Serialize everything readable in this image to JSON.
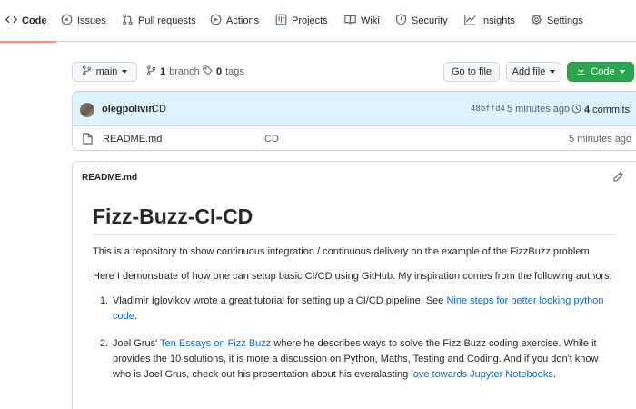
{
  "tabs": [
    {
      "label": "Code",
      "icon": "code-icon"
    },
    {
      "label": "Issues",
      "icon": "issue-icon"
    },
    {
      "label": "Pull requests",
      "icon": "pull-request-icon"
    },
    {
      "label": "Actions",
      "icon": "play-icon"
    },
    {
      "label": "Projects",
      "icon": "project-icon"
    },
    {
      "label": "Wiki",
      "icon": "book-icon"
    },
    {
      "label": "Security",
      "icon": "shield-icon"
    },
    {
      "label": "Insights",
      "icon": "graph-icon"
    },
    {
      "label": "Settings",
      "icon": "gear-icon"
    }
  ],
  "branch_bar": {
    "branch": "main",
    "branch_count": "1",
    "branch_word": "branch",
    "tag_count": "0",
    "tag_word": "tags",
    "go_to_file": "Go to file",
    "add_file": "Add file",
    "code_button": "Code"
  },
  "commit": {
    "author": "olegpolivin",
    "message": "CD",
    "sha": "48bffd4",
    "time": "5 minutes ago",
    "count": "4",
    "count_word": "commits"
  },
  "files": [
    {
      "name": "README.md",
      "message": "CD",
      "time": "5 minutes ago"
    }
  ],
  "readme": {
    "header": "README.md",
    "title": "Fizz-Buzz-CI-CD",
    "p1": "This is a repository to show continuous integration / continuous delivery on the example of the FizzBuzz problem",
    "p2": "Here I demonstrate of how one can setup basic CI/CD using GitHub. My inspiration comes from the following authors:",
    "item1": {
      "num": "1.",
      "text": "Vladimir Iglovikov wrote a great tutorial for setting up a CI/CD pipeline. See ",
      "link_a": "Nine steps for better looking python",
      "link_b": "code",
      "tail": "."
    },
    "item2": {
      "num": "2.",
      "pre": "Joel Grus' ",
      "link1": "Ten Essays on Fizz Buzz",
      "line1_tail": " where he describes ways to solve the Fizz Buzz coding exercise. While it",
      "line2": "provides the 10 solutions, it is more a discussion on Python, Maths, Testing and Coding. And if you don't know",
      "line3_pre": "who is Joel Grus, check out his presentation about his everalasting ",
      "link2": "love towards Jupyter Notebooks",
      "tail": "."
    }
  }
}
